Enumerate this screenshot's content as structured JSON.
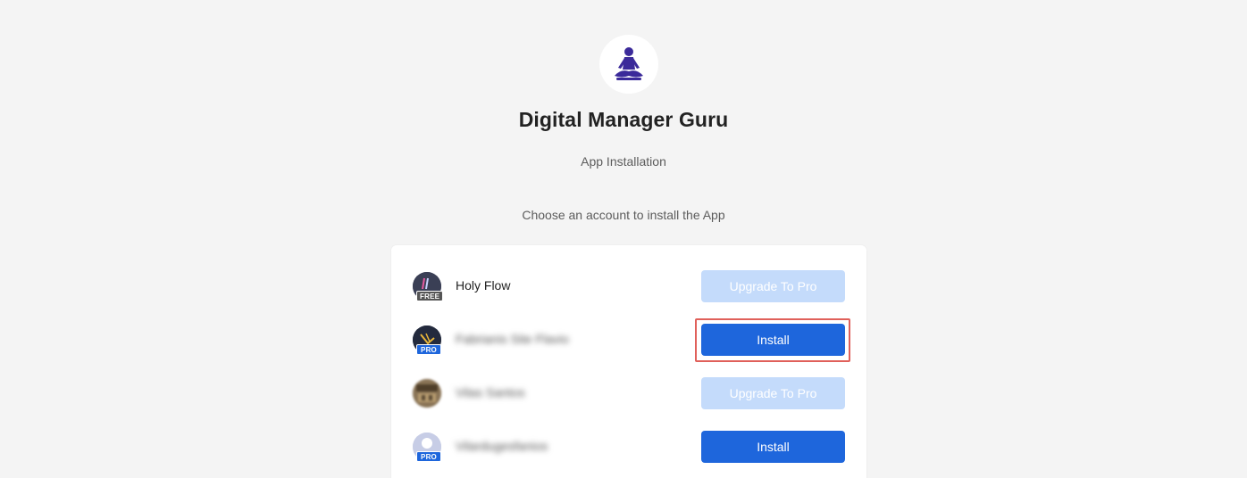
{
  "app": {
    "name": "Digital Manager Guru",
    "subtitle": "App Installation",
    "logo_icon": "meditation-figure-icon",
    "logo_color": "#3b2a9a"
  },
  "prompt": "Choose an account to install the App",
  "colors": {
    "primary": "#1e66dc",
    "primary_disabled": "#c4dbfb",
    "highlight": "#e0605a",
    "background": "#f4f4f4"
  },
  "accounts": [
    {
      "name": "Holy Flow",
      "plan": "FREE",
      "action_label": "Upgrade To Pro",
      "action_type": "upgrade",
      "blurred": false
    },
    {
      "name": "Fabrianis Site Flavio",
      "plan": "PRO",
      "action_label": "Install",
      "action_type": "install",
      "blurred": true,
      "highlighted": true
    },
    {
      "name": "Vilas Santos",
      "plan": "",
      "action_label": "Upgrade To Pro",
      "action_type": "upgrade",
      "blurred": true
    },
    {
      "name": "Vilardugesfanios",
      "plan": "PRO",
      "action_label": "Install",
      "action_type": "install",
      "blurred": true
    }
  ]
}
